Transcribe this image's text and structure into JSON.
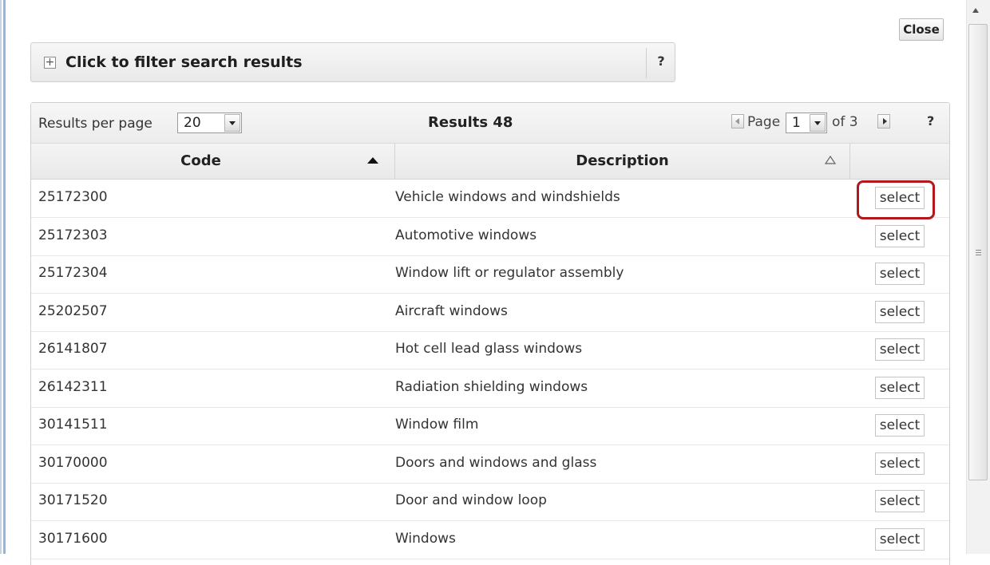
{
  "close_label": "Close",
  "filter": {
    "label": "Click to filter search results",
    "help": "?"
  },
  "toolbar": {
    "results_per_page_label": "Results per page",
    "results_per_page_value": "20",
    "results_count": "Results 48",
    "page_label": "Page",
    "page_value": "1",
    "of_label": "of 3",
    "help": "?"
  },
  "table": {
    "columns": [
      "Code",
      "Description",
      ""
    ],
    "select_label": "select",
    "rows": [
      {
        "code": "25172300",
        "description": "Vehicle windows and windshields"
      },
      {
        "code": "25172303",
        "description": "Automotive windows"
      },
      {
        "code": "25172304",
        "description": "Window lift or regulator assembly"
      },
      {
        "code": "25202507",
        "description": "Aircraft windows"
      },
      {
        "code": "26141807",
        "description": "Hot cell lead glass windows"
      },
      {
        "code": "26142311",
        "description": "Radiation shielding windows"
      },
      {
        "code": "30141511",
        "description": "Window film"
      },
      {
        "code": "30170000",
        "description": "Doors and windows and glass"
      },
      {
        "code": "30171520",
        "description": "Door and window loop"
      },
      {
        "code": "30171600",
        "description": "Windows"
      }
    ]
  },
  "colors": {
    "highlight": "#b3161b",
    "accent_edge": "#9eb3cf"
  },
  "icons": {
    "expand": "plus-icon",
    "sort_code": "sort-ascending-icon",
    "sort_description": "sort-ascending-outline-icon",
    "prev": "page-prev-icon",
    "next": "page-next-icon"
  }
}
